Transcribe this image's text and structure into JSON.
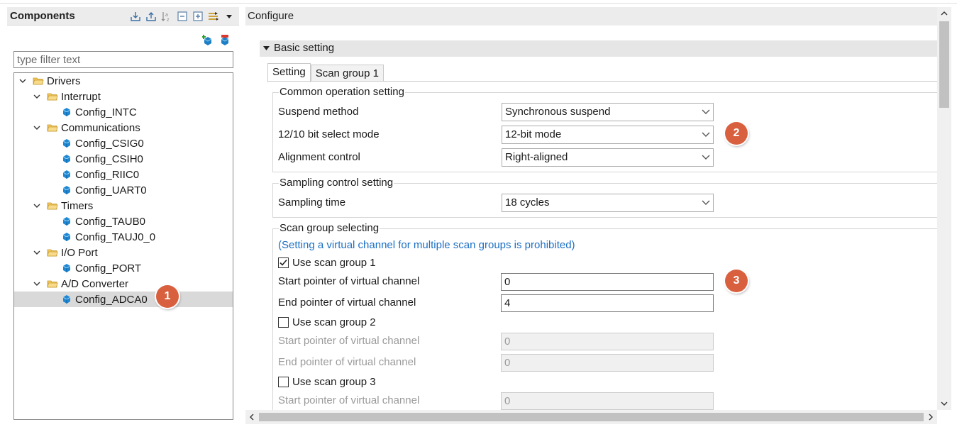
{
  "components_panel": {
    "title": "Components",
    "filter_placeholder": "type filter text",
    "header_tools": [
      "collapse-icon",
      "expand-icon",
      "sort-alpha-icon",
      "minimize-icon",
      "maximize-icon",
      "filter-icon",
      "view-menu-icon"
    ],
    "sub_tools": [
      "add-component-icon",
      "remove-component-icon"
    ],
    "tree": [
      {
        "label": "Drivers",
        "level": 0,
        "type": "folder",
        "expanded": true
      },
      {
        "label": "Interrupt",
        "level": 1,
        "type": "folder",
        "expanded": true
      },
      {
        "label": "Config_INTC",
        "level": 2,
        "type": "component"
      },
      {
        "label": "Communications",
        "level": 1,
        "type": "folder",
        "expanded": true
      },
      {
        "label": "Config_CSIG0",
        "level": 2,
        "type": "component"
      },
      {
        "label": "Config_CSIH0",
        "level": 2,
        "type": "component"
      },
      {
        "label": "Config_RIIC0",
        "level": 2,
        "type": "component"
      },
      {
        "label": "Config_UART0",
        "level": 2,
        "type": "component"
      },
      {
        "label": "Timers",
        "level": 1,
        "type": "folder",
        "expanded": true
      },
      {
        "label": "Config_TAUB0",
        "level": 2,
        "type": "component"
      },
      {
        "label": "Config_TAUJ0_0",
        "level": 2,
        "type": "component"
      },
      {
        "label": "I/O Port",
        "level": 1,
        "type": "folder",
        "expanded": true
      },
      {
        "label": "Config_PORT",
        "level": 2,
        "type": "component"
      },
      {
        "label": "A/D Converter",
        "level": 1,
        "type": "folder",
        "expanded": true
      },
      {
        "label": "Config_ADCA0",
        "level": 2,
        "type": "component",
        "selected": true
      }
    ]
  },
  "callouts": {
    "one": "1",
    "two": "2",
    "three": "3",
    "color": "#d9603f"
  },
  "configure": {
    "title": "Configure",
    "section_title": "Basic setting",
    "tabs": [
      {
        "label": "Setting",
        "active": true
      },
      {
        "label": "Scan group 1",
        "active": false
      }
    ],
    "common_operation": {
      "title": "Common operation setting",
      "suspend_label": "Suspend method",
      "suspend_value": "Synchronous suspend",
      "bitmode_label": "12/10 bit select mode",
      "bitmode_value": "12-bit mode",
      "alignment_label": "Alignment control",
      "alignment_value": "Right-aligned"
    },
    "sampling": {
      "title": "Sampling control setting",
      "time_label": "Sampling time",
      "time_value": "18 cycles"
    },
    "scan_groups": {
      "title": "Scan group selecting",
      "note": "(Setting a virtual channel for multiple scan groups is prohibited)",
      "group1": {
        "label": "Use scan group 1",
        "checked": true,
        "start_label": "Start pointer of virtual channel",
        "start_value": "0",
        "end_label": "End pointer of virtual channel",
        "end_value": "4"
      },
      "group2": {
        "label": "Use scan group 2",
        "checked": false,
        "start_label": "Start pointer of virtual channel",
        "start_value": "0",
        "end_label": "End pointer of virtual channel",
        "end_value": "0"
      },
      "group3": {
        "label": "Use scan group 3",
        "checked": false,
        "start_label": "Start pointer of virtual channel",
        "start_value": "0"
      }
    }
  }
}
